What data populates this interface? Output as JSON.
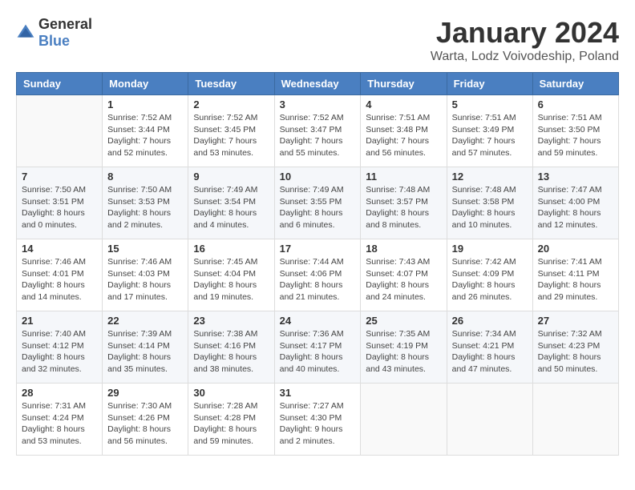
{
  "logo": {
    "general": "General",
    "blue": "Blue"
  },
  "title": {
    "month": "January 2024",
    "location": "Warta, Lodz Voivodeship, Poland"
  },
  "weekdays": [
    "Sunday",
    "Monday",
    "Tuesday",
    "Wednesday",
    "Thursday",
    "Friday",
    "Saturday"
  ],
  "weeks": [
    [
      {
        "day": "",
        "sunrise": "",
        "sunset": "",
        "daylight": ""
      },
      {
        "day": "1",
        "sunrise": "Sunrise: 7:52 AM",
        "sunset": "Sunset: 3:44 PM",
        "daylight": "Daylight: 7 hours and 52 minutes."
      },
      {
        "day": "2",
        "sunrise": "Sunrise: 7:52 AM",
        "sunset": "Sunset: 3:45 PM",
        "daylight": "Daylight: 7 hours and 53 minutes."
      },
      {
        "day": "3",
        "sunrise": "Sunrise: 7:52 AM",
        "sunset": "Sunset: 3:47 PM",
        "daylight": "Daylight: 7 hours and 55 minutes."
      },
      {
        "day": "4",
        "sunrise": "Sunrise: 7:51 AM",
        "sunset": "Sunset: 3:48 PM",
        "daylight": "Daylight: 7 hours and 56 minutes."
      },
      {
        "day": "5",
        "sunrise": "Sunrise: 7:51 AM",
        "sunset": "Sunset: 3:49 PM",
        "daylight": "Daylight: 7 hours and 57 minutes."
      },
      {
        "day": "6",
        "sunrise": "Sunrise: 7:51 AM",
        "sunset": "Sunset: 3:50 PM",
        "daylight": "Daylight: 7 hours and 59 minutes."
      }
    ],
    [
      {
        "day": "7",
        "sunrise": "Sunrise: 7:50 AM",
        "sunset": "Sunset: 3:51 PM",
        "daylight": "Daylight: 8 hours and 0 minutes."
      },
      {
        "day": "8",
        "sunrise": "Sunrise: 7:50 AM",
        "sunset": "Sunset: 3:53 PM",
        "daylight": "Daylight: 8 hours and 2 minutes."
      },
      {
        "day": "9",
        "sunrise": "Sunrise: 7:49 AM",
        "sunset": "Sunset: 3:54 PM",
        "daylight": "Daylight: 8 hours and 4 minutes."
      },
      {
        "day": "10",
        "sunrise": "Sunrise: 7:49 AM",
        "sunset": "Sunset: 3:55 PM",
        "daylight": "Daylight: 8 hours and 6 minutes."
      },
      {
        "day": "11",
        "sunrise": "Sunrise: 7:48 AM",
        "sunset": "Sunset: 3:57 PM",
        "daylight": "Daylight: 8 hours and 8 minutes."
      },
      {
        "day": "12",
        "sunrise": "Sunrise: 7:48 AM",
        "sunset": "Sunset: 3:58 PM",
        "daylight": "Daylight: 8 hours and 10 minutes."
      },
      {
        "day": "13",
        "sunrise": "Sunrise: 7:47 AM",
        "sunset": "Sunset: 4:00 PM",
        "daylight": "Daylight: 8 hours and 12 minutes."
      }
    ],
    [
      {
        "day": "14",
        "sunrise": "Sunrise: 7:46 AM",
        "sunset": "Sunset: 4:01 PM",
        "daylight": "Daylight: 8 hours and 14 minutes."
      },
      {
        "day": "15",
        "sunrise": "Sunrise: 7:46 AM",
        "sunset": "Sunset: 4:03 PM",
        "daylight": "Daylight: 8 hours and 17 minutes."
      },
      {
        "day": "16",
        "sunrise": "Sunrise: 7:45 AM",
        "sunset": "Sunset: 4:04 PM",
        "daylight": "Daylight: 8 hours and 19 minutes."
      },
      {
        "day": "17",
        "sunrise": "Sunrise: 7:44 AM",
        "sunset": "Sunset: 4:06 PM",
        "daylight": "Daylight: 8 hours and 21 minutes."
      },
      {
        "day": "18",
        "sunrise": "Sunrise: 7:43 AM",
        "sunset": "Sunset: 4:07 PM",
        "daylight": "Daylight: 8 hours and 24 minutes."
      },
      {
        "day": "19",
        "sunrise": "Sunrise: 7:42 AM",
        "sunset": "Sunset: 4:09 PM",
        "daylight": "Daylight: 8 hours and 26 minutes."
      },
      {
        "day": "20",
        "sunrise": "Sunrise: 7:41 AM",
        "sunset": "Sunset: 4:11 PM",
        "daylight": "Daylight: 8 hours and 29 minutes."
      }
    ],
    [
      {
        "day": "21",
        "sunrise": "Sunrise: 7:40 AM",
        "sunset": "Sunset: 4:12 PM",
        "daylight": "Daylight: 8 hours and 32 minutes."
      },
      {
        "day": "22",
        "sunrise": "Sunrise: 7:39 AM",
        "sunset": "Sunset: 4:14 PM",
        "daylight": "Daylight: 8 hours and 35 minutes."
      },
      {
        "day": "23",
        "sunrise": "Sunrise: 7:38 AM",
        "sunset": "Sunset: 4:16 PM",
        "daylight": "Daylight: 8 hours and 38 minutes."
      },
      {
        "day": "24",
        "sunrise": "Sunrise: 7:36 AM",
        "sunset": "Sunset: 4:17 PM",
        "daylight": "Daylight: 8 hours and 40 minutes."
      },
      {
        "day": "25",
        "sunrise": "Sunrise: 7:35 AM",
        "sunset": "Sunset: 4:19 PM",
        "daylight": "Daylight: 8 hours and 43 minutes."
      },
      {
        "day": "26",
        "sunrise": "Sunrise: 7:34 AM",
        "sunset": "Sunset: 4:21 PM",
        "daylight": "Daylight: 8 hours and 47 minutes."
      },
      {
        "day": "27",
        "sunrise": "Sunrise: 7:32 AM",
        "sunset": "Sunset: 4:23 PM",
        "daylight": "Daylight: 8 hours and 50 minutes."
      }
    ],
    [
      {
        "day": "28",
        "sunrise": "Sunrise: 7:31 AM",
        "sunset": "Sunset: 4:24 PM",
        "daylight": "Daylight: 8 hours and 53 minutes."
      },
      {
        "day": "29",
        "sunrise": "Sunrise: 7:30 AM",
        "sunset": "Sunset: 4:26 PM",
        "daylight": "Daylight: 8 hours and 56 minutes."
      },
      {
        "day": "30",
        "sunrise": "Sunrise: 7:28 AM",
        "sunset": "Sunset: 4:28 PM",
        "daylight": "Daylight: 8 hours and 59 minutes."
      },
      {
        "day": "31",
        "sunrise": "Sunrise: 7:27 AM",
        "sunset": "Sunset: 4:30 PM",
        "daylight": "Daylight: 9 hours and 2 minutes."
      },
      {
        "day": "",
        "sunrise": "",
        "sunset": "",
        "daylight": ""
      },
      {
        "day": "",
        "sunrise": "",
        "sunset": "",
        "daylight": ""
      },
      {
        "day": "",
        "sunrise": "",
        "sunset": "",
        "daylight": ""
      }
    ]
  ]
}
